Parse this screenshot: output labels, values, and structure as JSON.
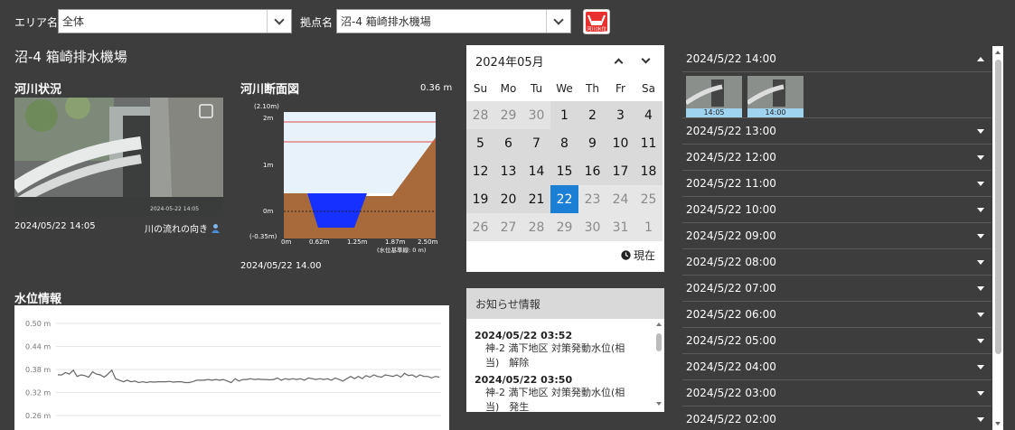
{
  "filters": {
    "area_label": "エリア名",
    "area_value": "全体",
    "site_label": "拠点名",
    "site_value": "沼-4 箱崎排水機場",
    "water_button_label": "河川水位"
  },
  "site_title": "沼-4 箱崎排水機場",
  "river_status": {
    "title": "河川状況",
    "timestamp": "2024/05/22 14:05",
    "flow_label": "川の流れの向き",
    "overlay_text": "2024-05-22 14:05"
  },
  "cross_section": {
    "title": "河川断面図",
    "current_level": "0.36 m",
    "top_label": "(2.10m)",
    "y_labels": [
      "2m",
      "1m",
      "0m",
      "(-0.35m)"
    ],
    "x_labels": [
      "0m",
      "0.62m",
      "1.25m",
      "1.87m",
      "2.50m"
    ],
    "baseline_note": "(水位基準線: 0 m)",
    "timestamp": "2024/05/22 14.00"
  },
  "water_level": {
    "title": "水位情報",
    "chart_data": {
      "type": "line",
      "y_ticks": [
        "0.50 m",
        "0.44 m",
        "0.38 m",
        "0.32 m",
        "0.26 m"
      ],
      "ylim": [
        0.26,
        0.5
      ],
      "values": [
        0.366,
        0.366,
        0.372,
        0.368,
        0.378,
        0.362,
        0.366,
        0.364,
        0.36,
        0.374,
        0.368,
        0.366,
        0.36,
        0.368,
        0.378,
        0.356,
        0.352,
        0.348,
        0.352,
        0.348,
        0.35,
        0.346,
        0.348,
        0.346,
        0.348,
        0.347,
        0.348,
        0.348,
        0.348,
        0.349,
        0.347,
        0.348,
        0.348,
        0.346,
        0.346,
        0.348,
        0.352,
        0.352,
        0.352,
        0.354,
        0.352,
        0.354,
        0.352,
        0.354,
        0.35,
        0.346,
        0.356,
        0.35,
        0.354,
        0.354,
        0.356,
        0.354,
        0.355,
        0.354,
        0.354,
        0.353,
        0.354,
        0.358,
        0.352,
        0.356,
        0.354,
        0.356,
        0.354,
        0.356,
        0.352,
        0.358,
        0.356,
        0.354,
        0.356,
        0.354,
        0.356,
        0.352,
        0.358,
        0.354,
        0.35,
        0.356,
        0.362,
        0.356,
        0.362,
        0.356,
        0.364,
        0.36,
        0.366,
        0.362,
        0.36,
        0.366,
        0.364,
        0.362,
        0.366,
        0.36,
        0.37,
        0.364,
        0.366,
        0.36,
        0.366,
        0.362,
        0.362,
        0.358,
        0.362,
        0.36
      ]
    }
  },
  "calendar": {
    "month_label": "2024年05月",
    "weekdays": [
      "Su",
      "Mo",
      "Tu",
      "We",
      "Th",
      "Fr",
      "Sa"
    ],
    "days": [
      {
        "d": "28",
        "t": "other"
      },
      {
        "d": "29",
        "t": "other"
      },
      {
        "d": "30",
        "t": "other"
      },
      {
        "d": "1",
        "t": "norm"
      },
      {
        "d": "2",
        "t": "norm"
      },
      {
        "d": "3",
        "t": "norm"
      },
      {
        "d": "4",
        "t": "norm"
      },
      {
        "d": "5",
        "t": "norm"
      },
      {
        "d": "6",
        "t": "norm"
      },
      {
        "d": "7",
        "t": "norm"
      },
      {
        "d": "8",
        "t": "norm"
      },
      {
        "d": "9",
        "t": "norm"
      },
      {
        "d": "10",
        "t": "norm"
      },
      {
        "d": "11",
        "t": "norm"
      },
      {
        "d": "12",
        "t": "norm"
      },
      {
        "d": "13",
        "t": "norm"
      },
      {
        "d": "14",
        "t": "norm"
      },
      {
        "d": "15",
        "t": "norm"
      },
      {
        "d": "16",
        "t": "norm"
      },
      {
        "d": "17",
        "t": "norm"
      },
      {
        "d": "18",
        "t": "norm"
      },
      {
        "d": "19",
        "t": "norm"
      },
      {
        "d": "20",
        "t": "norm"
      },
      {
        "d": "21",
        "t": "norm"
      },
      {
        "d": "22",
        "t": "sel"
      },
      {
        "d": "23",
        "t": "future"
      },
      {
        "d": "24",
        "t": "future"
      },
      {
        "d": "25",
        "t": "future"
      },
      {
        "d": "26",
        "t": "future"
      },
      {
        "d": "27",
        "t": "future"
      },
      {
        "d": "28",
        "t": "future"
      },
      {
        "d": "29",
        "t": "future"
      },
      {
        "d": "30",
        "t": "future"
      },
      {
        "d": "31",
        "t": "future"
      },
      {
        "d": "1",
        "t": "future"
      }
    ],
    "now_label": "現在"
  },
  "notice": {
    "title": "お知らせ情報",
    "items": [
      {
        "date": "2024/05/22 03:52",
        "line1": "神-2 満下地区 対策発動水位(相",
        "line2": "当)　解除"
      },
      {
        "date": "2024/05/22 03:50",
        "line1": "神-2 満下地区 対策発動水位(相",
        "line2": "当)　発生"
      }
    ]
  },
  "history": {
    "expanded": {
      "label": "2024/5/22 14:00",
      "thumbs": [
        "14:05",
        "14:00"
      ]
    },
    "items": [
      "2024/5/22 13:00",
      "2024/5/22 12:00",
      "2024/5/22 11:00",
      "2024/5/22 10:00",
      "2024/5/22 09:00",
      "2024/5/22 08:00",
      "2024/5/22 07:00",
      "2024/5/22 06:00",
      "2024/5/22 05:00",
      "2024/5/22 04:00",
      "2024/5/22 03:00",
      "2024/5/22 02:00"
    ]
  },
  "colors": {
    "selected_day": "#1c7fd6",
    "water": "#1530ff",
    "earth": "#a86a3a"
  }
}
